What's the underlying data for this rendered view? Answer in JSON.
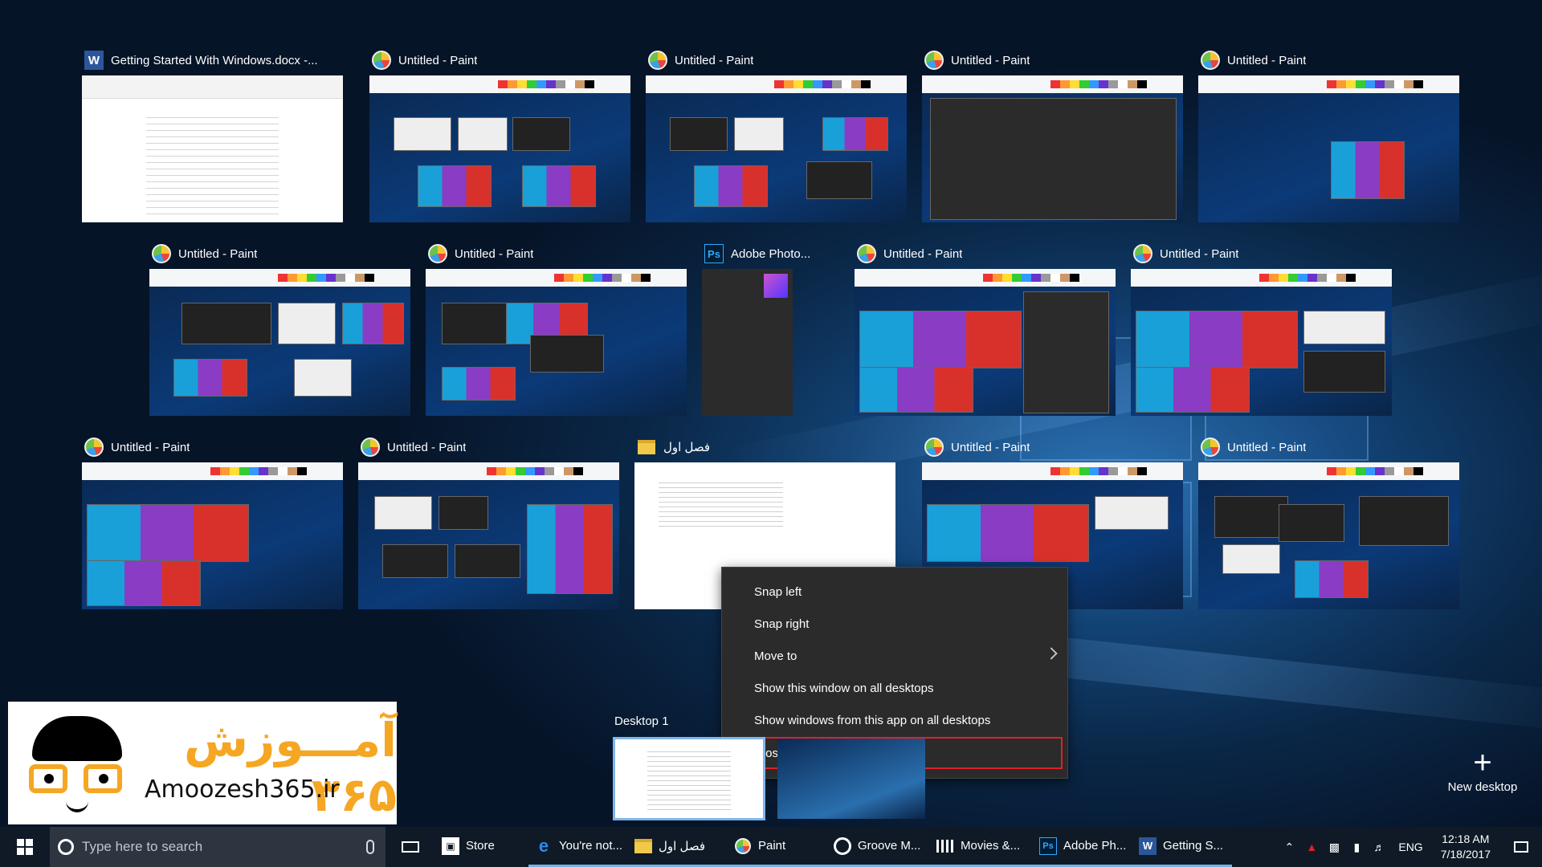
{
  "windows": [
    {
      "title": "Getting Started With Windows.docx -...",
      "app": "word"
    },
    {
      "title": "Untitled - Paint",
      "app": "paint"
    },
    {
      "title": "Untitled - Paint",
      "app": "paint"
    },
    {
      "title": "Untitled - Paint",
      "app": "paint"
    },
    {
      "title": "Untitled - Paint",
      "app": "paint"
    },
    {
      "title": "Untitled - Paint",
      "app": "paint"
    },
    {
      "title": "Untitled - Paint",
      "app": "paint"
    },
    {
      "title": "Adobe Photo...",
      "app": "photoshop"
    },
    {
      "title": "Untitled - Paint",
      "app": "paint"
    },
    {
      "title": "Untitled - Paint",
      "app": "paint"
    },
    {
      "title": "Untitled - Paint",
      "app": "paint"
    },
    {
      "title": "Untitled - Paint",
      "app": "paint"
    },
    {
      "title": "فصل اول",
      "app": "explorer"
    },
    {
      "title": "Untitled - Paint",
      "app": "paint"
    },
    {
      "title": "Untitled - Paint",
      "app": "paint"
    }
  ],
  "context_menu": {
    "items": [
      "Snap left",
      "Snap right",
      "Move to",
      "Show this window on all desktops",
      "Show windows from this app on all desktops",
      "Close"
    ]
  },
  "desktops": {
    "desktop1_label": "Desktop 1",
    "new_desktop_label": "New desktop"
  },
  "watermark": {
    "arabic": "آمـــوزش ۳۶۵",
    "site": "Amoozesh365.ir"
  },
  "taskbar": {
    "search_placeholder": "Type here to search",
    "apps": [
      {
        "label": "Store",
        "icon": "store-icon"
      },
      {
        "label": "You're not...",
        "icon": "edge-icon"
      },
      {
        "label": "فصل اول",
        "icon": "folder-icon"
      },
      {
        "label": "Paint",
        "icon": "paint-icon"
      },
      {
        "label": "Groove M...",
        "icon": "groove-icon"
      },
      {
        "label": "Movies &...",
        "icon": "movies-icon"
      },
      {
        "label": "Adobe Ph...",
        "icon": "photoshop-icon"
      },
      {
        "label": "Getting S...",
        "icon": "word-icon"
      }
    ],
    "lang": "ENG",
    "time": "12:18 AM",
    "date": "7/18/2017"
  },
  "colors": {
    "accent": "#7ab0e0",
    "close_highlight": "#e0202a",
    "watermark_orange": "#f5a623"
  }
}
